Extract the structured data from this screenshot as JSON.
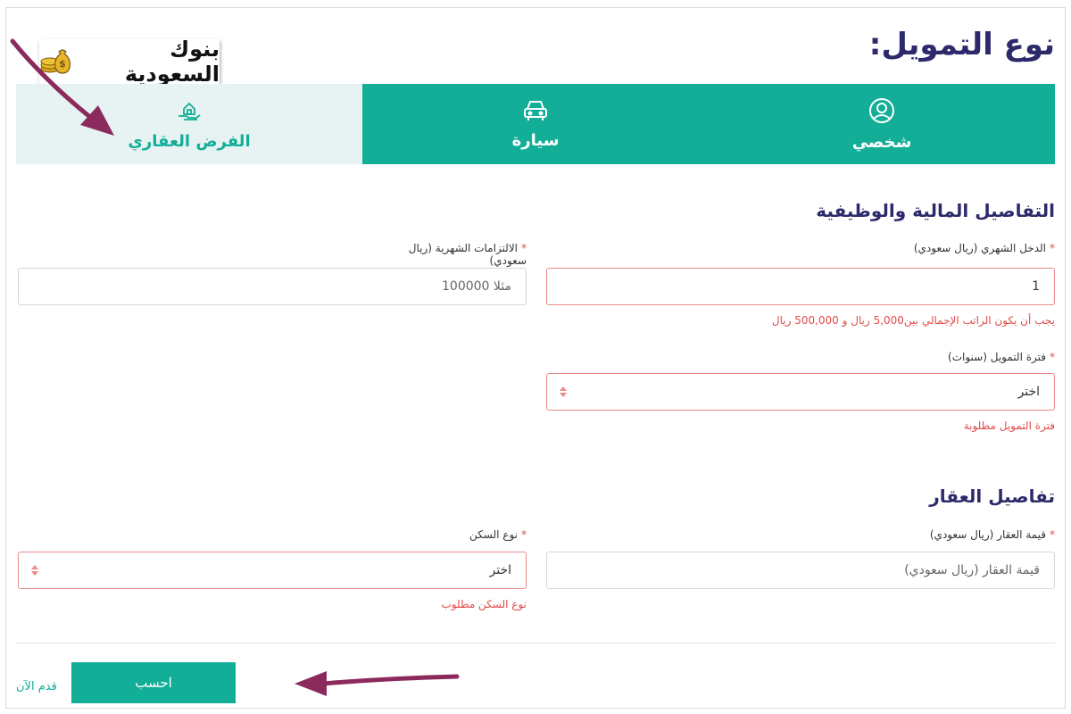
{
  "page": {
    "title": "نوع التمويل:"
  },
  "watermark": {
    "text": "بنوك السعودية"
  },
  "tabs": [
    {
      "label": "شخصي",
      "icon": "user-circle-icon",
      "active": true
    },
    {
      "label": "سيارة",
      "icon": "car-icon",
      "active": true
    },
    {
      "label": "الفرض العقاري",
      "icon": "house-hand-icon",
      "active": false
    }
  ],
  "financial": {
    "title": "التفاصيل المالية والوظيفية",
    "monthly_income": {
      "label": "الدخل الشهري (ريال سعودي)",
      "value": "1",
      "error": "يجب أن يكون الراتب الإجمالي بين5,000 ريال و 500,000 ريال"
    },
    "monthly_obligations": {
      "label": "الالتزامات الشهرية (ريال سعودي)",
      "placeholder": "مثلا 100000"
    },
    "finance_period": {
      "label": "فترة التمويل (سنوات)",
      "value": "اختر",
      "error": "فترة التمويل مطلوبة"
    }
  },
  "property": {
    "title": "تفاصيل العقار",
    "value_field": {
      "label": "قيمة العقار (ريال سعودي)",
      "placeholder": "قيمة العقار (ريال سعودي)"
    },
    "housing_type": {
      "label": "نوع السكن",
      "value": "اختر",
      "error": "نوع السكن مطلوب"
    }
  },
  "actions": {
    "calculate": "احسب",
    "apply_now": "قدم الآن"
  },
  "colors": {
    "teal": "#12ae97",
    "navy": "#2d2a6b",
    "error": "#e24b4b",
    "arrow": "#8b2a5c"
  }
}
